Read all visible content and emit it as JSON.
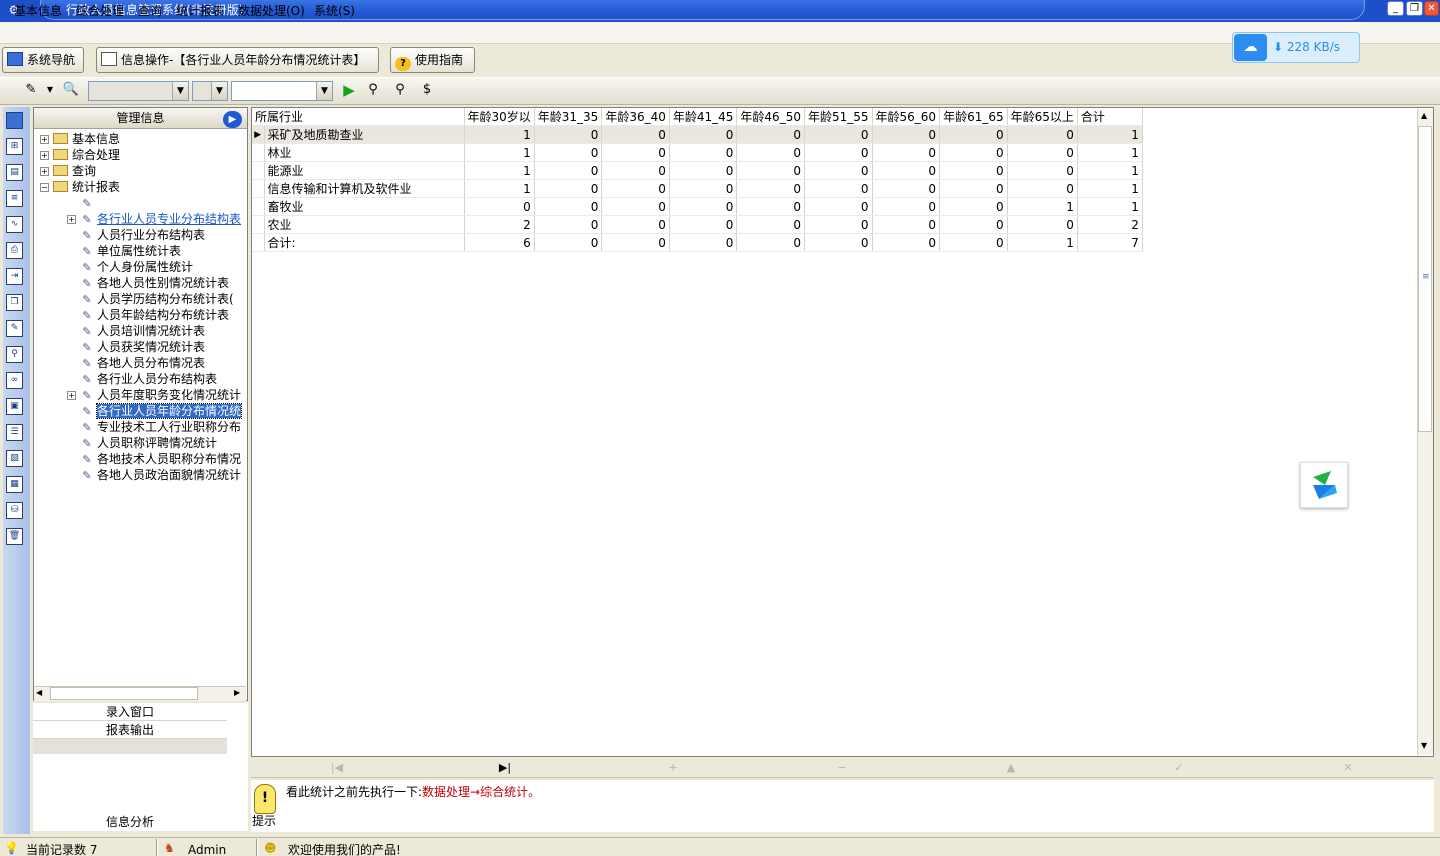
{
  "window": {
    "title": "行政人员信息管理系统(非注册版)"
  },
  "menu": [
    "基本信息",
    "综合处理",
    "查询",
    "统计报表",
    "数据处理(O)",
    "系统(S)"
  ],
  "nav_buttons": {
    "system_nav": "系统导航",
    "info_op": "信息操作-【各行业人员年龄分布情况统计表】",
    "guide": "使用指南"
  },
  "speed": {
    "value": "228 KB/s"
  },
  "tree": {
    "header": "管理信息",
    "folders": [
      "基本信息",
      "综合处理",
      "查询",
      "统计报表"
    ],
    "reports": [
      "",
      "各行业人员专业分布结构表",
      "人员行业分布结构表",
      "单位属性统计表",
      "个人身份属性统计",
      "各地人员性别情况统计表",
      "人员学历结构分布统计表(",
      "人员年龄结构分布统计表",
      "人员培训情况统计表",
      "人员获奖情况统计表",
      "各地人员分布情况表",
      "各行业人员分布结构表",
      "人员年度职务变化情况统计",
      "各行业人员年龄分布情况统",
      "专业技术工人行业职称分布",
      "人员职称评聘情况统计",
      "各地技术人员职称分布情况",
      "各地人员政治面貌情况统计"
    ]
  },
  "bottom_panel": {
    "items": [
      "录入窗口",
      "报表输出"
    ],
    "analysis": "信息分析"
  },
  "grid": {
    "columns": [
      "所属行业",
      "年龄30岁以",
      "年龄31_35",
      "年龄36_40",
      "年龄41_45",
      "年龄46_50",
      "年龄51_55",
      "年龄56_60",
      "年龄61_65",
      "年龄65以上",
      "合计"
    ],
    "rows": [
      [
        "采矿及地质勘查业",
        "1",
        "0",
        "0",
        "0",
        "0",
        "0",
        "0",
        "0",
        "0",
        "1"
      ],
      [
        "林业",
        "1",
        "0",
        "0",
        "0",
        "0",
        "0",
        "0",
        "0",
        "0",
        "1"
      ],
      [
        "能源业",
        "1",
        "0",
        "0",
        "0",
        "0",
        "0",
        "0",
        "0",
        "0",
        "1"
      ],
      [
        "信息传输和计算机及软件业",
        "1",
        "0",
        "0",
        "0",
        "0",
        "0",
        "0",
        "0",
        "0",
        "1"
      ],
      [
        "畜牧业",
        "0",
        "0",
        "0",
        "0",
        "0",
        "0",
        "0",
        "0",
        "1",
        "1"
      ],
      [
        "农业",
        "2",
        "0",
        "0",
        "0",
        "0",
        "0",
        "0",
        "0",
        "0",
        "2"
      ],
      [
        "合计:",
        "6",
        "0",
        "0",
        "0",
        "0",
        "0",
        "0",
        "0",
        "1",
        "7"
      ]
    ]
  },
  "hint": {
    "label": "提示",
    "text": "看此统计之前先执行一下:",
    "link": "数据处理→综合统计。"
  },
  "status": {
    "records": "当前记录数 7",
    "user": "Admin",
    "welcome": "欢迎使用我们的产品!"
  }
}
